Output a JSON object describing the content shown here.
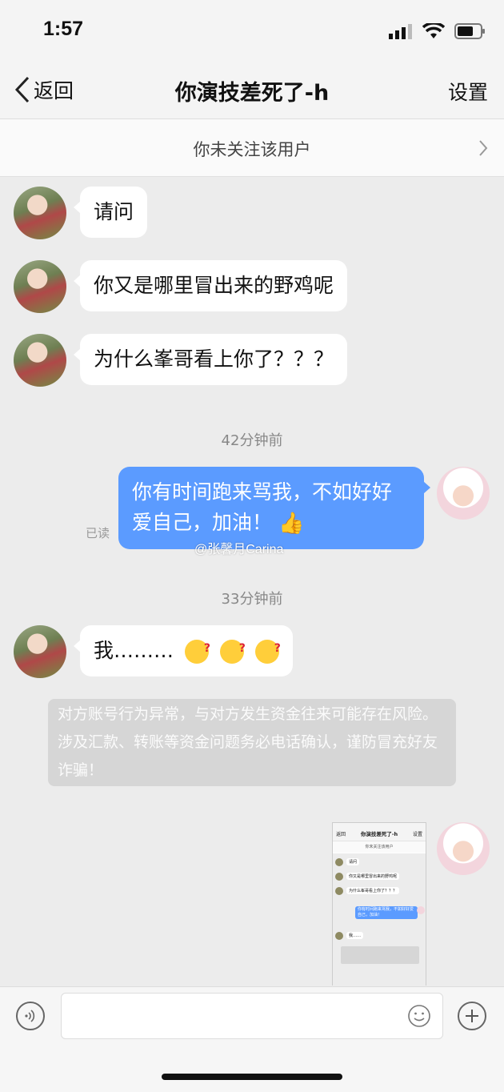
{
  "status_bar": {
    "time": "1:57"
  },
  "nav": {
    "back_label": "返回",
    "title": "你演技差死了-h",
    "settings_label": "设置"
  },
  "follow_notice": {
    "text": "你未关注该用户"
  },
  "messages": [
    {
      "side": "left",
      "text": "请问"
    },
    {
      "side": "left",
      "text": "你又是哪里冒出来的野鸡呢"
    },
    {
      "side": "left",
      "text": "为什么峯哥看上你了？？？"
    },
    {
      "timestamp": "42分钟前"
    },
    {
      "side": "right",
      "text": "你有时间跑来骂我，不如好好爱自己，加油！",
      "read_status": "已读"
    },
    {
      "timestamp": "33分钟前"
    },
    {
      "side": "left",
      "text": "我………"
    }
  ],
  "watermark": "@张馨月Carina",
  "warning": {
    "text": "对方账号行为异常，与对方发生资金往来可能存在风险。涉及汇款、转账等资金问题务必电话确认，谨防冒充好友诈骗！"
  },
  "screenshot_thumb": {
    "back": "返回",
    "title": "你演技差死了-h",
    "settings": "设置",
    "follow": "你未关注该用户",
    "lines": [
      "请问",
      "你又是哪里冒出来的野鸡呢",
      "为什么峯哥看上你了？？？",
      "你有时间跑来骂我，不如好好爱自己，加油！",
      "我……"
    ]
  },
  "icons": {
    "voice": "voice-icon",
    "emoji": "emoji-icon",
    "add": "add-icon"
  },
  "colors": {
    "sent_bubble": "#5b9bff",
    "received_bubble": "#ffffff",
    "background": "#ececec"
  }
}
